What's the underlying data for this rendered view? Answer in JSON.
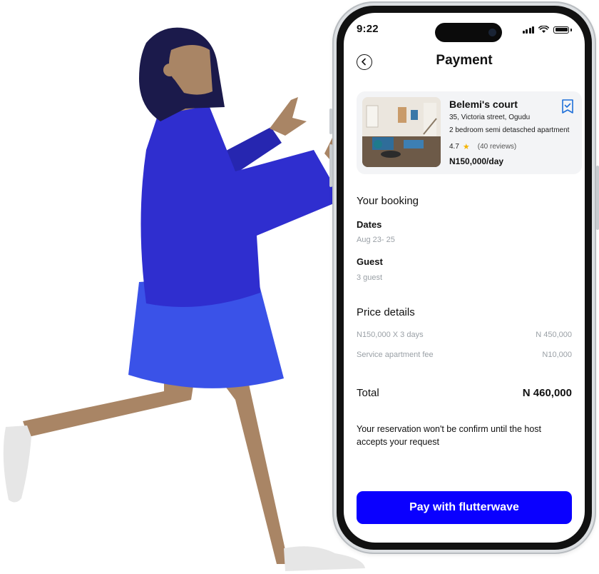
{
  "status": {
    "time": "9:22"
  },
  "header": {
    "title": "Payment"
  },
  "listing": {
    "name": "Belemi's court",
    "address": "35, Victoria street, Ogudu",
    "type": "2 bedroom semi detasched apartment",
    "rating": "4.7",
    "reviews": "(40 reviews)",
    "price": "N150,000/day"
  },
  "booking": {
    "section_title": "Your booking",
    "dates_label": "Dates",
    "dates_value": "Aug 23- 25",
    "guest_label": "Guest",
    "guest_value": "3 guest"
  },
  "price_details": {
    "section_title": "Price details",
    "rows": [
      {
        "label": "N150,000 X 3 days",
        "amount": "N 450,000"
      },
      {
        "label": "Service apartment fee",
        "amount": "N10,000"
      }
    ],
    "total_label": "Total",
    "total_amount": "N 460,000"
  },
  "notice": "Your reservation won't be confirm until the host accepts your request",
  "pay_button": {
    "label": "Pay with flutterwave"
  },
  "colors": {
    "accent": "#0a00ff",
    "jacket": "#2f2ecf",
    "skirt": "#3a52e8",
    "skin": "#a98565",
    "hair": "#1b1a4b"
  }
}
